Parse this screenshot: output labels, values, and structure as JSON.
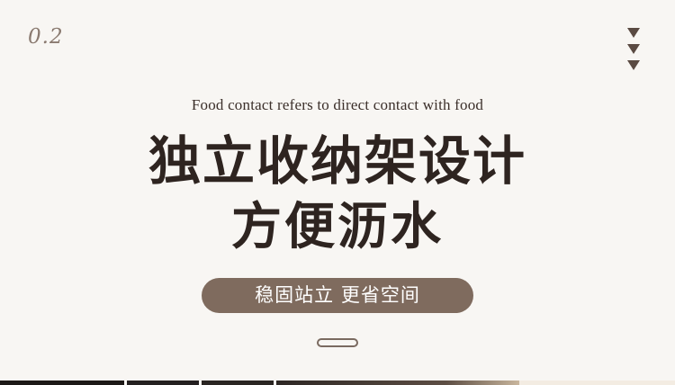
{
  "section": {
    "number": "0.2"
  },
  "nav": {
    "icon": "triple-down-arrow-icon"
  },
  "content": {
    "subtitle": "Food contact refers to direct contact with food",
    "headline_line1": "独立收纳架设计",
    "headline_line2": "方便沥水",
    "pill_text": "稳固站立 更省空间"
  },
  "colors": {
    "background": "#f8f6f3",
    "headline": "#2e2420",
    "pill": "#7f6b5e",
    "accent_text": "#8a7a70"
  }
}
